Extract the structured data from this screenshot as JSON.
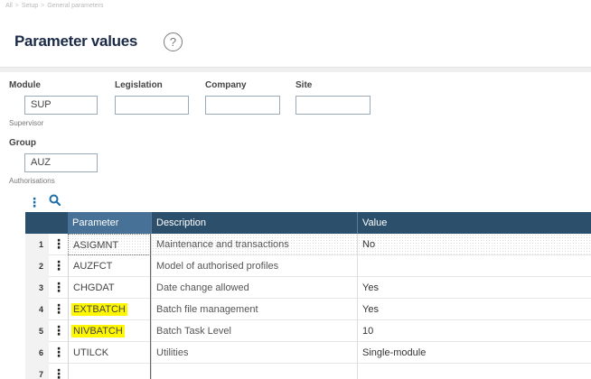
{
  "breadcrumb": [
    "All",
    "Setup",
    "General parameters"
  ],
  "page": {
    "title": "Parameter values",
    "help_glyph": "?"
  },
  "fields": {
    "module": {
      "label": "Module",
      "value": "SUP",
      "description": "Supervisor"
    },
    "legislation": {
      "label": "Legislation",
      "value": ""
    },
    "company": {
      "label": "Company",
      "value": ""
    },
    "site": {
      "label": "Site",
      "value": ""
    },
    "group": {
      "label": "Group",
      "value": "AUZ",
      "description": "Authorisations"
    }
  },
  "grid": {
    "columns": {
      "parameter": "Parameter",
      "description": "Description",
      "value": "Value"
    },
    "rows": [
      {
        "num": "1",
        "parameter": "ASIGMNT",
        "description": "Maintenance and transactions",
        "value": "No",
        "highlighted": false
      },
      {
        "num": "2",
        "parameter": "AUZFCT",
        "description": "Model of authorised profiles",
        "value": "",
        "highlighted": false
      },
      {
        "num": "3",
        "parameter": "CHGDAT",
        "description": "Date change allowed",
        "value": "Yes",
        "highlighted": false
      },
      {
        "num": "4",
        "parameter": "EXTBATCH",
        "description": "Batch file management",
        "value": "Yes",
        "highlighted": true
      },
      {
        "num": "5",
        "parameter": "NIVBATCH",
        "description": "Batch Task Level",
        "value": "10",
        "highlighted": true
      },
      {
        "num": "6",
        "parameter": "UTILCK",
        "description": "Utilities",
        "value": "Single-module",
        "highlighted": false
      },
      {
        "num": "7",
        "parameter": "",
        "description": "",
        "value": "",
        "highlighted": false
      }
    ]
  },
  "icons": {
    "row_menu": "vertical-dots-icon",
    "toolbar_menu": "vertical-dots-icon",
    "search": "search-icon",
    "help": "help-circle-icon"
  },
  "colors": {
    "header_bg": "#2c4f6b",
    "header_active": "#477196",
    "title": "#1b2b48",
    "accent": "#1d6ea8",
    "highlight": "#fff700"
  }
}
